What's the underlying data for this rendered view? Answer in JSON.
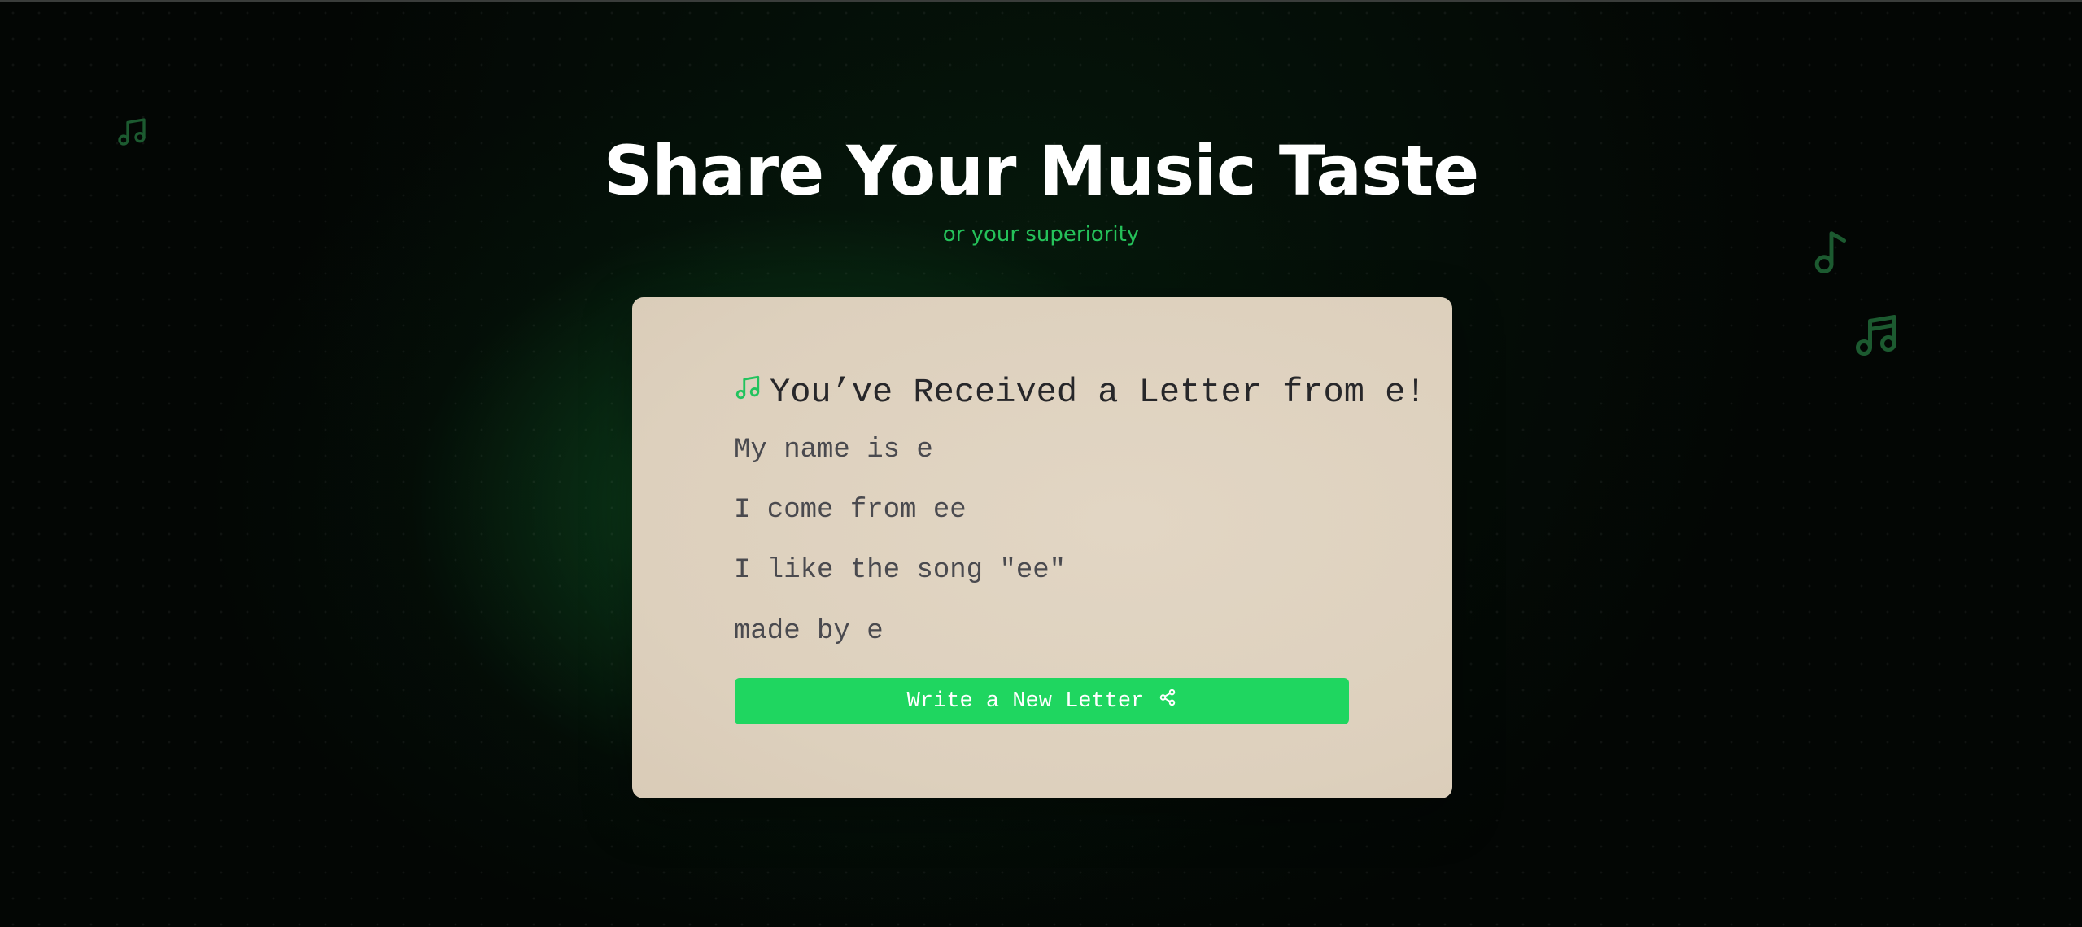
{
  "hero": {
    "title": "Share Your Music Taste",
    "subtitle": "or your superiority"
  },
  "letter": {
    "heading_icon": "music-note-icon",
    "heading": "You’ve Received a Letter from e!",
    "lines": [
      "My name is e",
      "I come from ee",
      "I like the song \"ee\"",
      "made by e"
    ],
    "button": {
      "label": "Write a New Letter",
      "icon": "share-icon"
    }
  },
  "decorations": [
    "music-notes-icon",
    "music-note-icon",
    "music-notes-icon"
  ],
  "colors": {
    "background": "#030604",
    "glow": "#166e30",
    "accent": "#1fd660",
    "subtitle": "#25c25a",
    "card": "#ddd0bd",
    "text": "#27272a"
  }
}
